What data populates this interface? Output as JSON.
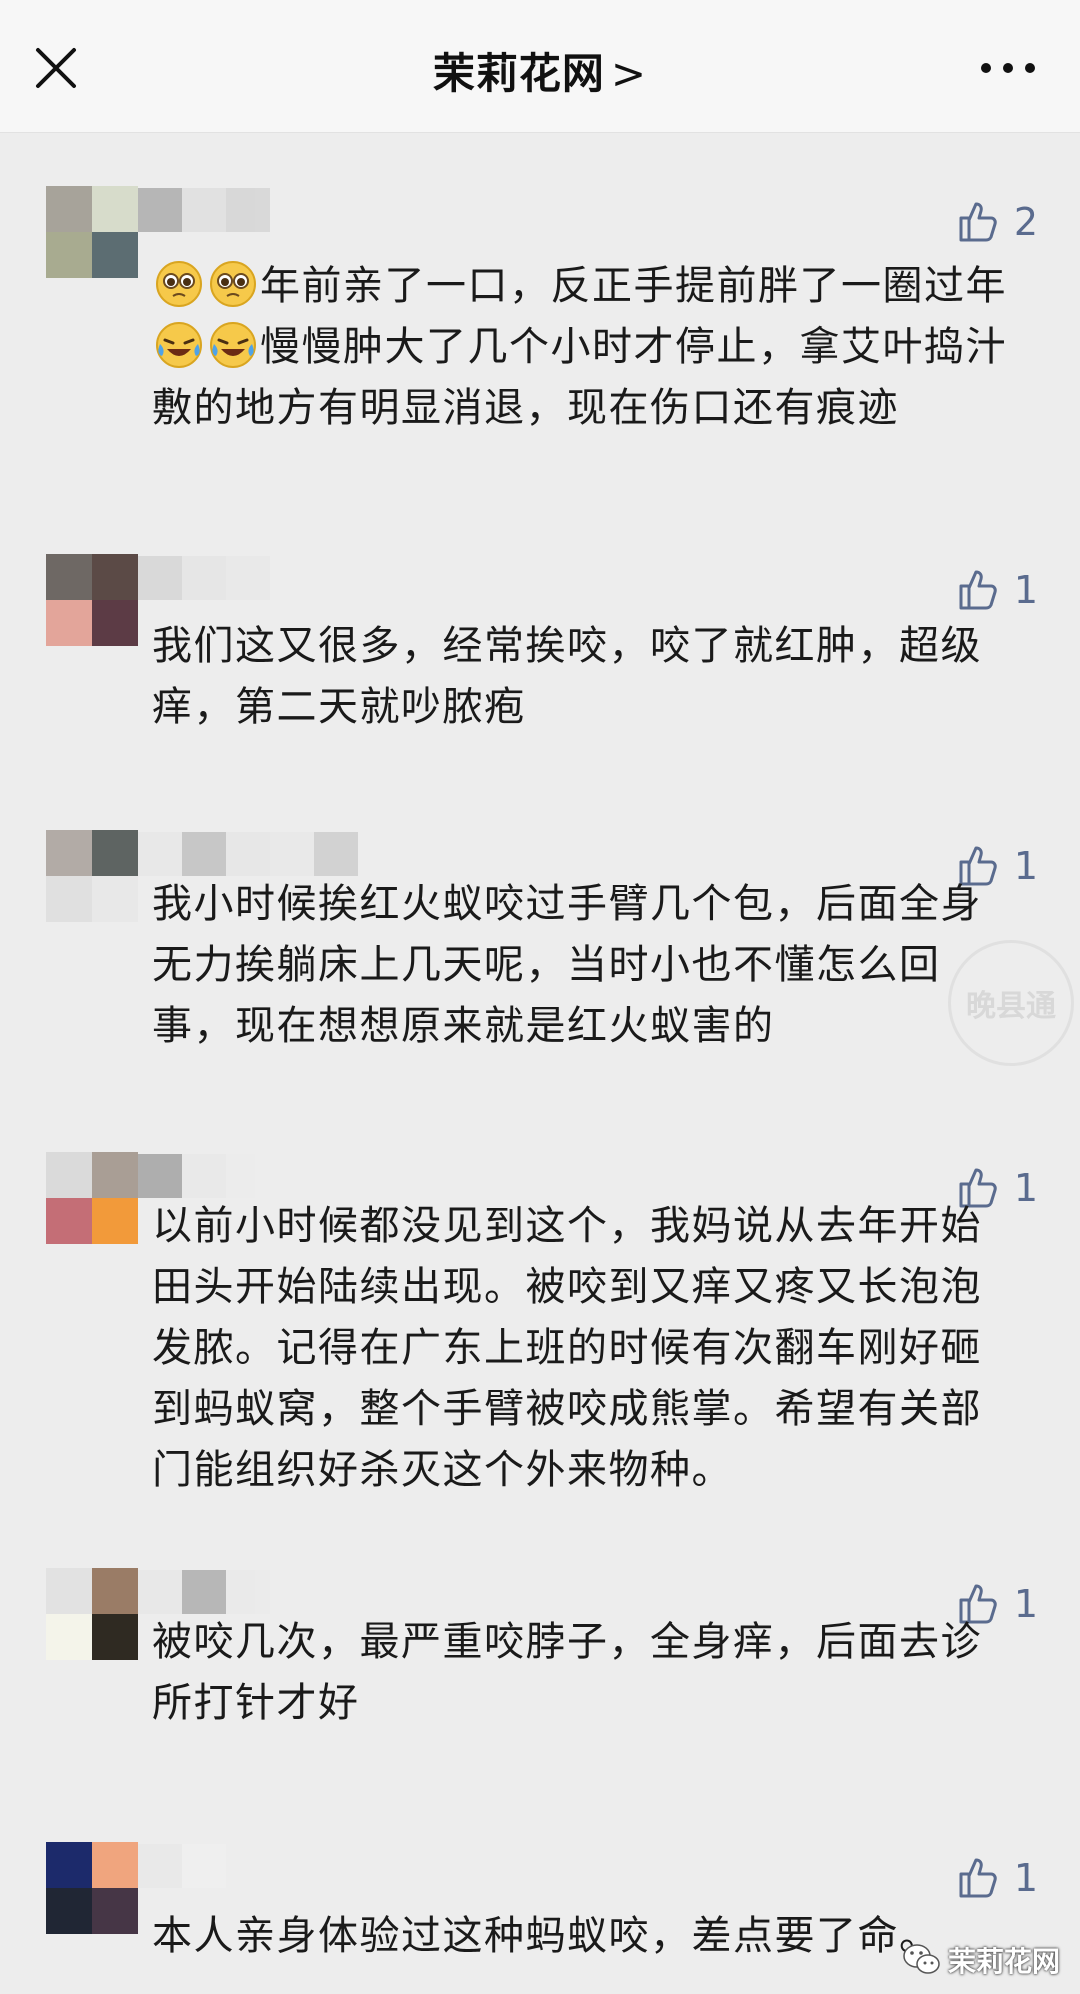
{
  "header": {
    "title": "茉莉花网",
    "chevron": ">"
  },
  "comments": [
    {
      "likes": "2",
      "text_parts": [
        "年前亲了一口，反正手提前胖了一圈过年",
        "慢慢肿大了几个小时才停止，拿艾叶捣汁敷的地方有明显消退，现在伤口还有痕迹"
      ]
    },
    {
      "likes": "1",
      "text": "我们这又很多，经常挨咬，咬了就红肿，超级痒，第二天就吵脓疱"
    },
    {
      "likes": "1",
      "text": "我小时候挨红火蚁咬过手臂几个包，后面全身无力挨躺床上几天呢，当时小也不懂怎么回事，现在想想原来就是红火蚁害的"
    },
    {
      "likes": "1",
      "text": "以前小时候都没见到这个，我妈说从去年开始田头开始陆续出现。被咬到又痒又疼又长泡泡发脓。记得在广东上班的时候有次翻车刚好砸到蚂蚁窝，整个手臂被咬成熊掌。希望有关部门能组织好杀灭这个外来物种。"
    },
    {
      "likes": "1",
      "text": "被咬几次，最严重咬脖子，全身痒，后面去诊所打针才好"
    },
    {
      "likes": "1",
      "text": "本人亲身体验过这种蚂蚁咬，差点要了命。"
    }
  ],
  "emoji_names": [
    "pleading-face",
    "pleading-face",
    "laughing-crying-face",
    "laughing-crying-face"
  ],
  "watermark": {
    "label": "茉莉花网",
    "stamp": "晚县通"
  },
  "colors": {
    "background": "#ededed",
    "like": "#5a6b8e",
    "text": "#1a1a1a"
  }
}
